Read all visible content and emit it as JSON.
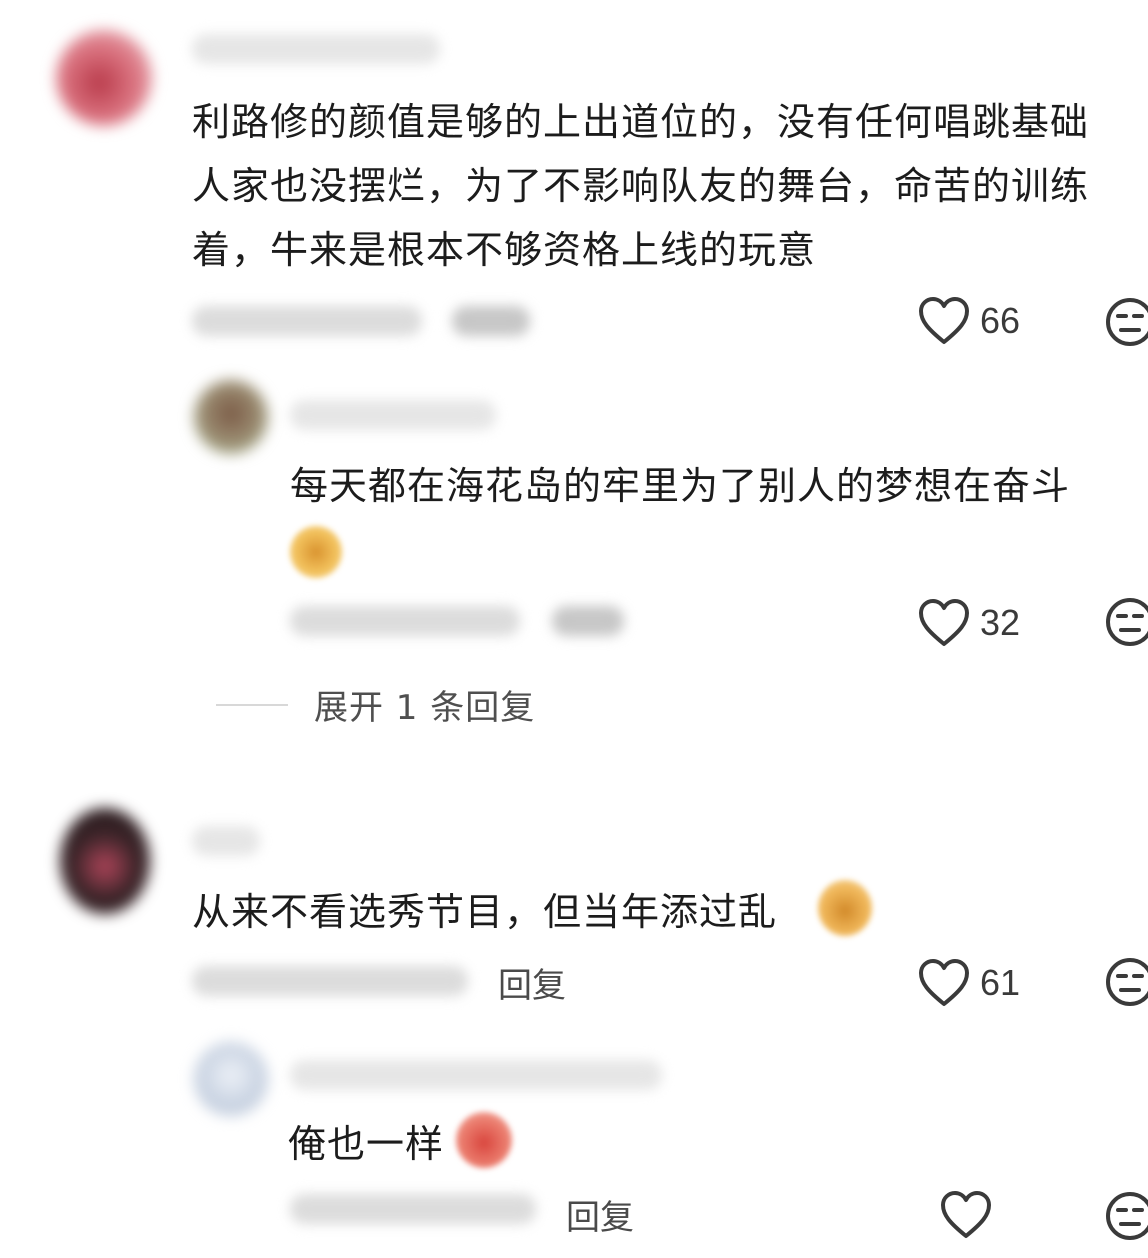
{
  "comments": [
    {
      "text_lines": [
        "利路修的颜值是够的上出道位的，没有任何唱跳基础",
        "人家也没摆烂，为了不影响队友的舞台，命苦的训练",
        "着，牛来是根本不够资格上线的玩意"
      ],
      "like_count": "66"
    },
    {
      "text_lines": [
        "每天都在海花岛的牢里为了别人的梦想在奋斗"
      ],
      "like_count": "32"
    },
    {
      "text_lines": [
        "从来不看选秀节目，但当年添过乱"
      ],
      "reply_label": "回复",
      "like_count": "61"
    },
    {
      "text_lines": [
        "俺也一样"
      ],
      "reply_label": "回复"
    }
  ],
  "expand_replies": {
    "label": "展开 1 条回复"
  },
  "icons": {
    "like": "heart-outline-icon",
    "dislike": "neutral-face-icon"
  },
  "colors": {
    "text": "#1c1c1c",
    "meta": "#4a4a4a",
    "icon_stroke": "#3a3a3a"
  }
}
